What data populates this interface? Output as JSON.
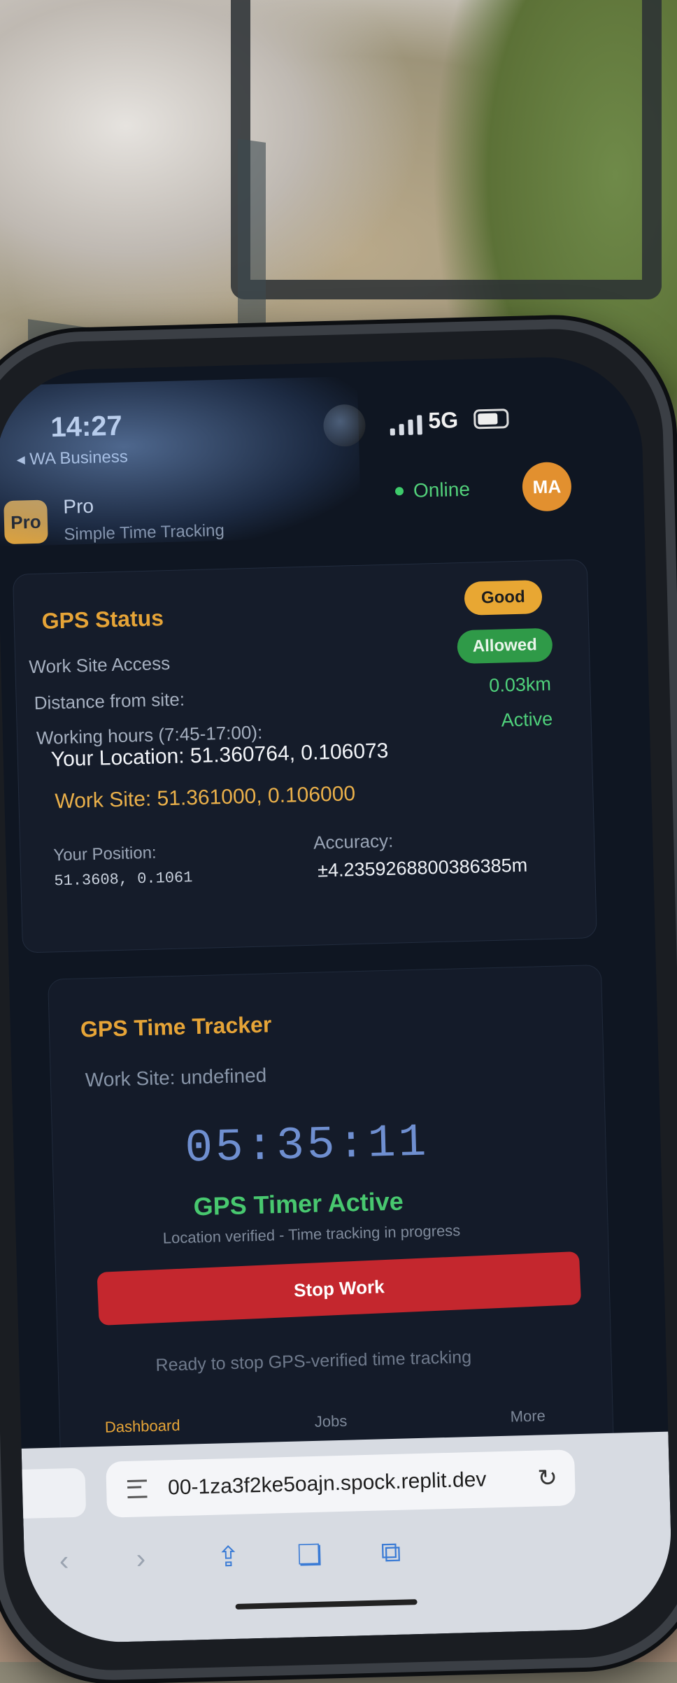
{
  "status_bar": {
    "time": "14:27",
    "back_app": "WA Business",
    "network": "5G"
  },
  "header": {
    "logo_text": "Pro",
    "app_name": "Pro",
    "app_subtitle": "Simple Time Tracking",
    "connection_status": "Online",
    "avatar_initials": "MA"
  },
  "gps_status": {
    "title": "GPS Status",
    "quality_badge": "Good",
    "work_site_access_label": "Work Site Access",
    "work_site_access_badge": "Allowed",
    "distance_label": "Distance from site:",
    "distance_value": "0.03km",
    "hours_label": "Working hours (7:45-17:00):",
    "hours_value": "Active",
    "your_location": "Your Location: 51.360764, 0.106073",
    "work_site": "Work Site: 51.361000, 0.106000",
    "position_label": "Your Position:",
    "position_value": "51.3608, 0.1061",
    "accuracy_label": "Accuracy:",
    "accuracy_value": "±4.2359268800386385m"
  },
  "tracker": {
    "title": "GPS Time Tracker",
    "work_site": "Work Site: undefined",
    "timer": "05:35:11",
    "status": "GPS Timer Active",
    "verified_text": "Location verified - Time tracking in progress",
    "stop_button": "Stop Work",
    "hint": "Ready to stop GPS-verified time tracking"
  },
  "nav": {
    "dashboard": "Dashboard",
    "jobs": "Jobs",
    "more": "More"
  },
  "browser": {
    "url": "00-1za3f2ke5oajn.spock.replit.dev"
  },
  "colors": {
    "accent": "#e6a437",
    "success": "#48c86f",
    "danger": "#c4272e",
    "background": "#0f1622"
  }
}
